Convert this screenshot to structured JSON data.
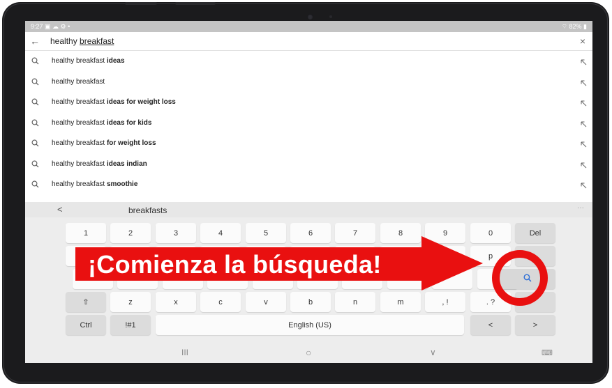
{
  "status": {
    "time": "9:27",
    "left_icons": "▣ ☁ ⚙ •",
    "right": "⌔ 82% ▮"
  },
  "search": {
    "back_icon": "←",
    "query_prefix": "healthy ",
    "query_underlined": "breakfast",
    "clear_icon": "×"
  },
  "suggestions": [
    {
      "base": "healthy breakfast",
      "bold": " ideas"
    },
    {
      "base": "healthy breakfast",
      "bold": ""
    },
    {
      "base": "healthy breakfast",
      "bold": " ideas for weight loss"
    },
    {
      "base": "healthy breakfast",
      "bold": " ideas for kids"
    },
    {
      "base": "healthy breakfast",
      "bold": " for weight loss"
    },
    {
      "base": "healthy breakfast",
      "bold": " ideas indian"
    },
    {
      "base": "healthy breakfast",
      "bold": " smoothie"
    }
  ],
  "keyboard": {
    "predict_back": "<",
    "prediction": "breakfasts",
    "predict_more": "···",
    "number_row": [
      "1",
      "2",
      "3",
      "4",
      "5",
      "6",
      "7",
      "8",
      "9",
      "0"
    ],
    "del_label": "Del",
    "row2_visible": [
      "p"
    ],
    "row4": [
      "⇧",
      "z",
      "x",
      "c",
      "v",
      "b",
      "n",
      "m",
      ", !",
      ". ?"
    ],
    "ctrl_label": "Ctrl",
    "sym_label": "!#1",
    "space_label": "English (US)",
    "left_label": "<",
    "right_label": ">"
  },
  "navbar": {
    "recent": "III",
    "home": "○",
    "back": "∨",
    "kbd": "⌨"
  },
  "overlay": {
    "banner_text": "¡Comienza la búsqueda!",
    "color": "#e91010"
  }
}
